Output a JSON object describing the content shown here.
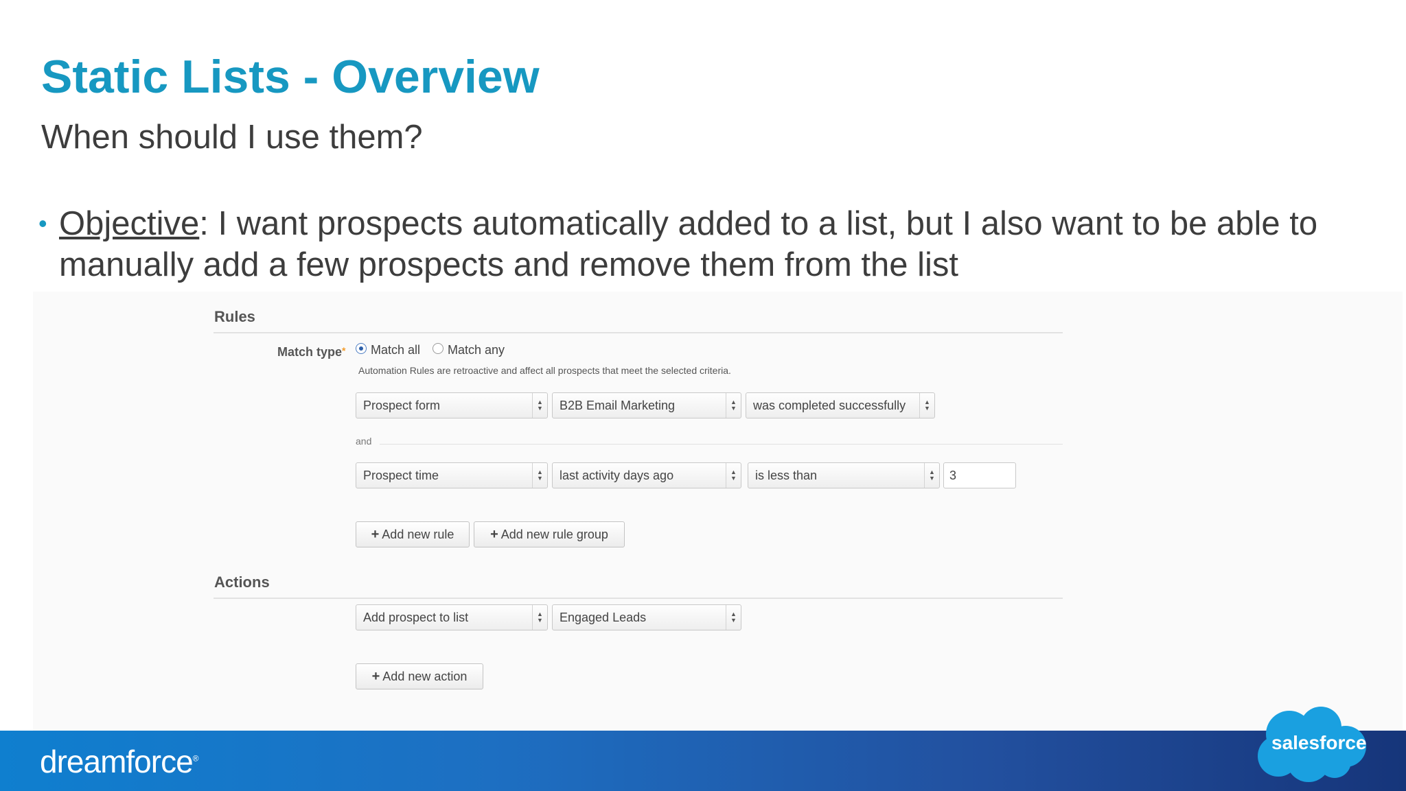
{
  "slide": {
    "title": "Static Lists - Overview",
    "subtitle": "When should I use them?",
    "bullet": {
      "label": "Objective",
      "text": ": I want prospects automatically added to a list, but I also want to be able to manually add a few prospects and remove them from the list"
    }
  },
  "rules": {
    "heading": "Rules",
    "match_type_label": "Match type",
    "required_marker": "*",
    "match_all_label": "Match all",
    "match_any_label": "Match any",
    "selected_match": "Match all",
    "help_text": "Automation Rules are retroactive and affect all prospects that meet the selected criteria.",
    "rule1": {
      "field": "Prospect form",
      "value": "B2B Email Marketing",
      "condition": "was completed successfully"
    },
    "joiner": "and",
    "rule2": {
      "field": "Prospect time",
      "value": "last activity days ago",
      "condition": "is less than",
      "input": "3"
    },
    "add_rule_label": "Add new rule",
    "add_group_label": "Add new rule group"
  },
  "actions": {
    "heading": "Actions",
    "action1": {
      "action": "Add prospect to list",
      "target": "Engaged Leads"
    },
    "add_action_label": "Add new action"
  },
  "footer": {
    "left_logo": "dreamforce",
    "trademark": "®",
    "right_logo": "salesforce"
  },
  "colors": {
    "title_blue": "#1798c1",
    "footer_blue": "#1d6fc2",
    "cloud_blue": "#1aa0e0"
  }
}
